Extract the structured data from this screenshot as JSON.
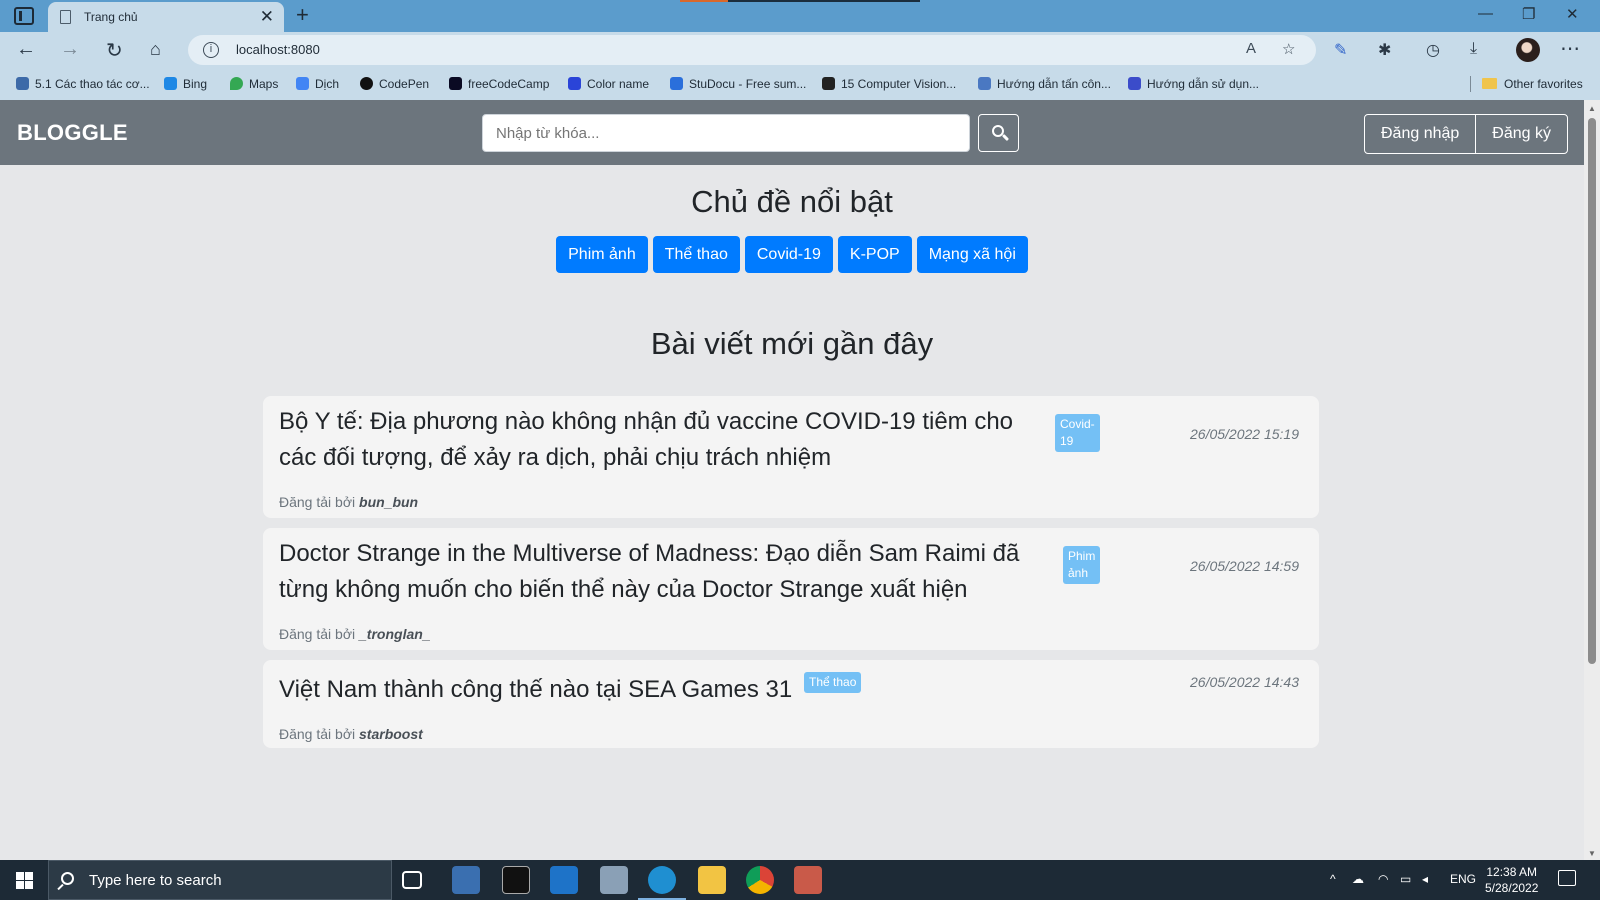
{
  "browser": {
    "tab_title": "Trang chủ",
    "url": "localhost:8080",
    "favorites": [
      {
        "label": "5.1 Các thao tác cơ...",
        "icon": "text-icon",
        "color": "#3d6aa8"
      },
      {
        "label": "Bing",
        "icon": "bing-icon",
        "color": "#1e88e5"
      },
      {
        "label": "Maps",
        "icon": "maps-pin-icon",
        "color": "#34a853"
      },
      {
        "label": "Dịch",
        "icon": "translate-icon",
        "color": "#4285f4"
      },
      {
        "label": "CodePen",
        "icon": "codepen-icon",
        "color": "#111111"
      },
      {
        "label": "freeCodeCamp",
        "icon": "freecodecamp-icon",
        "color": "#0a0a23"
      },
      {
        "label": "Color name",
        "icon": "color-name-icon",
        "color": "#2a44d8"
      },
      {
        "label": "StuDocu - Free sum...",
        "icon": "studocu-icon",
        "color": "#2a6fdb"
      },
      {
        "label": "15 Computer Vision...",
        "icon": "medium-icon",
        "color": "#222222"
      },
      {
        "label": "Hướng dẫn tấn côn...",
        "icon": "vulnerability-icon",
        "color": "#4a78c2"
      },
      {
        "label": "Hướng dẫn sử dụn...",
        "icon": "guide-icon",
        "color": "#3b4cca"
      }
    ],
    "other_favorites": "Other favorites"
  },
  "site": {
    "brand": "BLOGGLE",
    "search_placeholder": "Nhập từ khóa...",
    "login": "Đăng nhập",
    "register": "Đăng ký"
  },
  "topics": {
    "heading": "Chủ đề nổi bật",
    "items": [
      "Phim ảnh",
      "Thể thao",
      "Covid-19",
      "K-POP",
      "Mạng xã hội"
    ]
  },
  "recent": {
    "heading": "Bài viết mới gần đây",
    "posts": [
      {
        "title_line1": "Bộ Y tế: Địa phương nào không nhận đủ vaccine COVID-19 tiêm cho",
        "title_line2": "các đối tượng, để xảy ra dịch, phải chịu trách nhiệm",
        "badge_line1": "Covid-",
        "badge_line2": "19",
        "date": "26/05/2022 15:19",
        "author_prefix": "Đăng tải bởi",
        "author": "bun_bun"
      },
      {
        "title_line1": "Doctor Strange in the Multiverse of Madness: Đạo diễn Sam Raimi đã",
        "title_line2": "từng không muốn cho biến thể này của Doctor Strange xuất hiện",
        "badge_line1": "Phim",
        "badge_line2": "ảnh",
        "date": "26/05/2022 14:59",
        "author_prefix": "Đăng tải bởi",
        "author": "_tronglan_"
      },
      {
        "title_line1": "Việt Nam thành công thế nào tại SEA Games 31",
        "badge_line1": "Thể thao",
        "date": "26/05/2022 14:43",
        "author_prefix": "Đăng tải bởi",
        "author": "starboost"
      }
    ]
  },
  "taskbar": {
    "search_placeholder": "Type here to search",
    "language": "ENG",
    "time": "12:38 AM",
    "date": "5/28/2022"
  },
  "colors": {
    "navbar": "#6c757d",
    "topic_button": "#007bff",
    "badge": "#74c0f5",
    "browser_frame": "#5b9ccc"
  }
}
